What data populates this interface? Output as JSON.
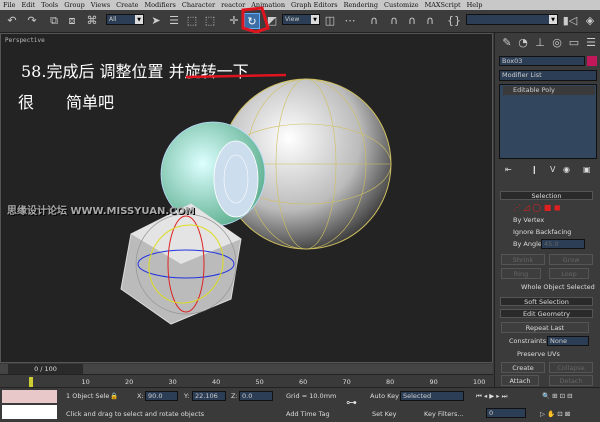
{
  "menu": [
    "File",
    "Edit",
    "Tools",
    "Group",
    "Views",
    "Create",
    "Modifiers",
    "Character",
    "reactor",
    "Animation",
    "Graph Editors",
    "Rendering",
    "Customize",
    "MAXScript",
    "Help"
  ],
  "toolbar": {
    "selection_filter": "All",
    "ref_coord": "View",
    "named_sel": ""
  },
  "viewport": {
    "label": "Perspective",
    "caption_line1": "58.完成后 调整位置 并旋转一下",
    "caption_line2": "很　　简单吧",
    "watermark": "思缘设计论坛 WWW.MISSYUAN.COM"
  },
  "panel": {
    "object_name": "Box03",
    "object_color": "#c0185a",
    "modifier_list": "Modifier List",
    "stack_item": "Editable Poly",
    "selection_title": "Selection",
    "by_vertex": "By Vertex",
    "ignore_backfacing": "Ignore Backfacing",
    "by_angle": "By Angle:",
    "angle_value": "45.0",
    "shrink": "Shrink",
    "grow": "Grow",
    "ring": "Ring",
    "loop": "Loop",
    "selection_status": "Whole Object Selected",
    "soft_selection": "Soft Selection",
    "edit_geometry": "Edit Geometry",
    "repeat_last": "Repeat Last",
    "constraints_label": "Constraints:",
    "constraints_value": "None",
    "preserve_uvs": "Preserve UVs",
    "create": "Create",
    "collapse": "Collapse",
    "attach": "Attach",
    "detach": "Detach"
  },
  "timeline": {
    "frame": "0 / 100",
    "ticks": [
      "10",
      "20",
      "30",
      "40",
      "50",
      "60",
      "70",
      "80",
      "90",
      "100"
    ]
  },
  "status": {
    "selected": "1 Object Sele",
    "x_label": "X:",
    "x": "90.0",
    "y_label": "Y:",
    "y": "22.106",
    "z_label": "Z:",
    "z": "0.0",
    "grid": "Grid = 10.0mm",
    "prompt": "Click and drag to select and rotate objects",
    "add_time_tag": "Add Time Tag",
    "auto_key": "Auto Key",
    "set_key": "Set Key",
    "key_mode": "Selected",
    "key_filters": "Key Filters...",
    "current_frame": "0"
  },
  "colors": {
    "highlight": "#e0141e",
    "active_tool": "#3a6ea5"
  }
}
